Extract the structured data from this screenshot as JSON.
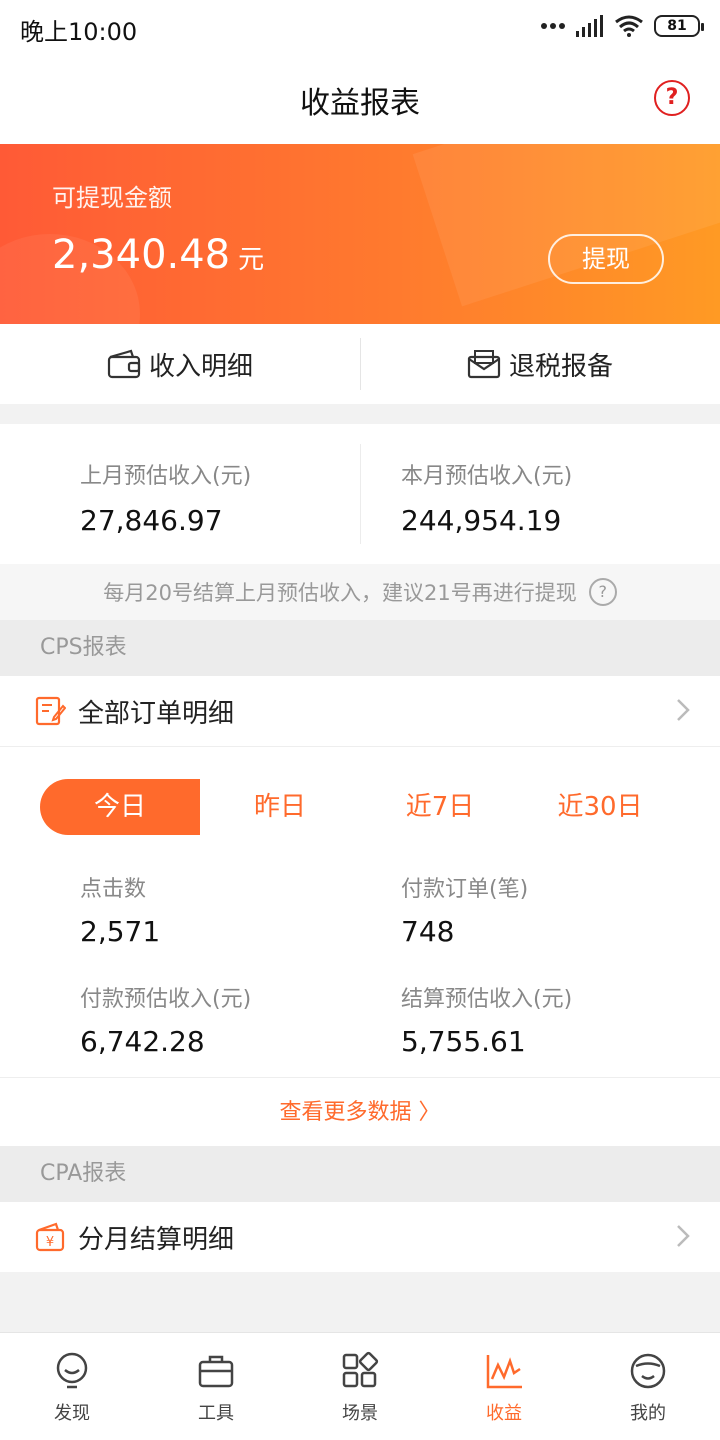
{
  "status_bar": {
    "time": "晚上10:00",
    "battery": "81"
  },
  "header": {
    "title": "收益报表",
    "help_glyph": "?"
  },
  "banner": {
    "label": "可提现金额",
    "amount": "2,340.48",
    "unit": "元",
    "withdraw_label": "提现"
  },
  "quick_actions": [
    {
      "label": "收入明细",
      "icon": "wallet-icon"
    },
    {
      "label": "退税报备",
      "icon": "envelope-icon"
    }
  ],
  "monthly": {
    "last_label": "上月预估收入(元)",
    "last_value": "27,846.97",
    "this_label": "本月预估收入(元)",
    "this_value": "244,954.19"
  },
  "notice": {
    "text": "每月20号结算上月预估收入，建议21号再进行提现",
    "help_glyph": "?"
  },
  "cps": {
    "section_label": "CPS报表",
    "orders_label": "全部订单明细",
    "tabs": [
      "今日",
      "昨日",
      "近7日",
      "近30日"
    ],
    "active_tab": 0,
    "stats": {
      "clicks_label": "点击数",
      "clicks_value": "2,571",
      "orders_label": "付款订单(笔)",
      "orders_value": "748",
      "paid_label": "付款预估收入(元)",
      "paid_value": "6,742.28",
      "settle_label": "结算预估收入(元)",
      "settle_value": "5,755.61"
    },
    "more_label": "查看更多数据 〉"
  },
  "cpa": {
    "section_label": "CPA报表",
    "monthly_label": "分月结算明细"
  },
  "nav": {
    "items": [
      {
        "label": "发现",
        "icon": "bulb-icon"
      },
      {
        "label": "工具",
        "icon": "briefcase-icon"
      },
      {
        "label": "场景",
        "icon": "grid-icon"
      },
      {
        "label": "收益",
        "icon": "chart-icon"
      },
      {
        "label": "我的",
        "icon": "face-icon"
      }
    ],
    "active": 3
  },
  "colors": {
    "accent": "#ff6a2c",
    "banner_start": "#ff5a36",
    "banner_end": "#ff9a24",
    "help_red": "#e02020"
  }
}
